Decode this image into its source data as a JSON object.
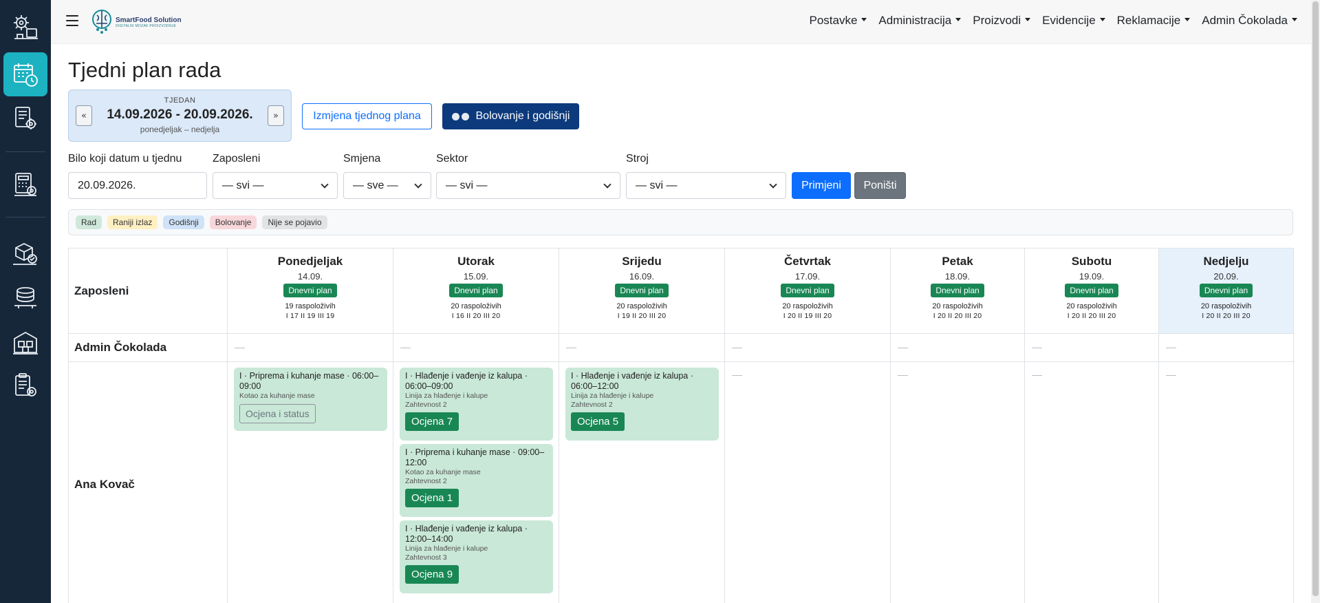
{
  "app": {
    "logo_title": "SmartFood Solution",
    "logo_subtitle": "DIGITALNI MOZAK PROIZVODNJE"
  },
  "sidebar": {
    "items": [
      {
        "icon": "factory-gear-icon"
      },
      {
        "icon": "calendar-clock-icon",
        "active": true
      },
      {
        "icon": "document-gear-icon"
      },
      {
        "icon": "calculator-gear-icon"
      },
      {
        "icon": "box-gear-icon"
      },
      {
        "icon": "stacked-trays-icon"
      },
      {
        "icon": "warehouse-icon"
      },
      {
        "icon": "clipboard-gear-icon"
      }
    ]
  },
  "nav": {
    "items": [
      "Postavke",
      "Administracija",
      "Proizvodi",
      "Evidencije",
      "Reklamacije",
      "Admin Čokolada"
    ]
  },
  "page": {
    "title": "Tjedni plan rada"
  },
  "week": {
    "label": "TJEDAN",
    "range": "14.09.2026 - 20.09.2026.",
    "days": "ponedjeljak – nedjelja",
    "prev": "«",
    "next": "»"
  },
  "actions": {
    "edit_plan": "Izmjena tjednog plana",
    "leave": "Bolovanje i godišnji"
  },
  "filters": {
    "date_label": "Bilo koji datum u tjednu",
    "date_value": "20.09.2026.",
    "employee_label": "Zaposleni",
    "employee_value": "— svi —",
    "shift_label": "Smjena",
    "shift_value": "— sve —",
    "sector_label": "Sektor",
    "sector_value": "— svi —",
    "machine_label": "Stroj",
    "machine_value": "— svi —",
    "apply": "Primjeni",
    "reset": "Poništi"
  },
  "legend": [
    {
      "label": "Rad",
      "color": "#cfe8dc"
    },
    {
      "label": "Raniji izlaz",
      "color": "#fff0c2"
    },
    {
      "label": "Godišnji",
      "color": "#cfe2f7"
    },
    {
      "label": "Bolovanje",
      "color": "#f8d7da"
    },
    {
      "label": "Nije se pojavio",
      "color": "#e2e3e5"
    }
  ],
  "grid": {
    "employee_header": "Zaposleni",
    "days": [
      {
        "name": "Ponedjeljak",
        "date": "14.09.",
        "plan": "Dnevni plan",
        "available": "19 raspoloživih",
        "shifts": "I 17  II 19  III 19"
      },
      {
        "name": "Utorak",
        "date": "15.09.",
        "plan": "Dnevni plan",
        "available": "20 raspoloživih",
        "shifts": "I 16  II 20  III 20"
      },
      {
        "name": "Srijedu",
        "date": "16.09.",
        "plan": "Dnevni plan",
        "available": "20 raspoloživih",
        "shifts": "I 19  II 20  III 20"
      },
      {
        "name": "Četvrtak",
        "date": "17.09.",
        "plan": "Dnevni plan",
        "available": "20 raspoloživih",
        "shifts": "I 20  II 19  III 20"
      },
      {
        "name": "Petak",
        "date": "18.09.",
        "plan": "Dnevni plan",
        "available": "20 raspoloživih",
        "shifts": "I 20  II 20  III 20"
      },
      {
        "name": "Subotu",
        "date": "19.09.",
        "plan": "Dnevni plan",
        "available": "20 raspoloživih",
        "shifts": "I 20  II 20  III 20"
      },
      {
        "name": "Nedjelju",
        "date": "20.09.",
        "plan": "Dnevni plan",
        "available": "20 raspoloživih",
        "shifts": "I 20  II 20  III 20"
      }
    ],
    "employees": [
      {
        "name": "Admin Čokolada"
      },
      {
        "name": "Ana Kovač"
      }
    ],
    "tasks": {
      "mon": {
        "title": "I · Priprema i kuhanje mase · 06:00–09:00",
        "machine": "Kotao za kuhanje mase",
        "button": "Ocjena i status"
      },
      "tue1": {
        "title": "I · Hlađenje i vađenje iz kalupa · 06:00–09:00",
        "machine": "Linija za hlađenje i kalupe",
        "complexity": "Zahtevnost 2",
        "button": "Ocjena 7"
      },
      "tue2": {
        "title": "I · Priprema i kuhanje mase · 09:00–12:00",
        "machine": "Kotao za kuhanje mase",
        "complexity": "Zahtevnost 2",
        "button": "Ocjena 1"
      },
      "tue3": {
        "title": "I · Hlađenje i vađenje iz kalupa · 12:00–14:00",
        "machine": "Linija za hlađenje i kalupe",
        "complexity": "Zahtevnost 3",
        "button": "Ocjena 9"
      },
      "wed": {
        "title": "I · Hlađenje i vađenje iz kalupa · 06:00–12:00",
        "machine": "Linija za hlađenje i kalupe",
        "complexity": "Zahtevnost 2",
        "button": "Ocjena 5"
      }
    }
  }
}
